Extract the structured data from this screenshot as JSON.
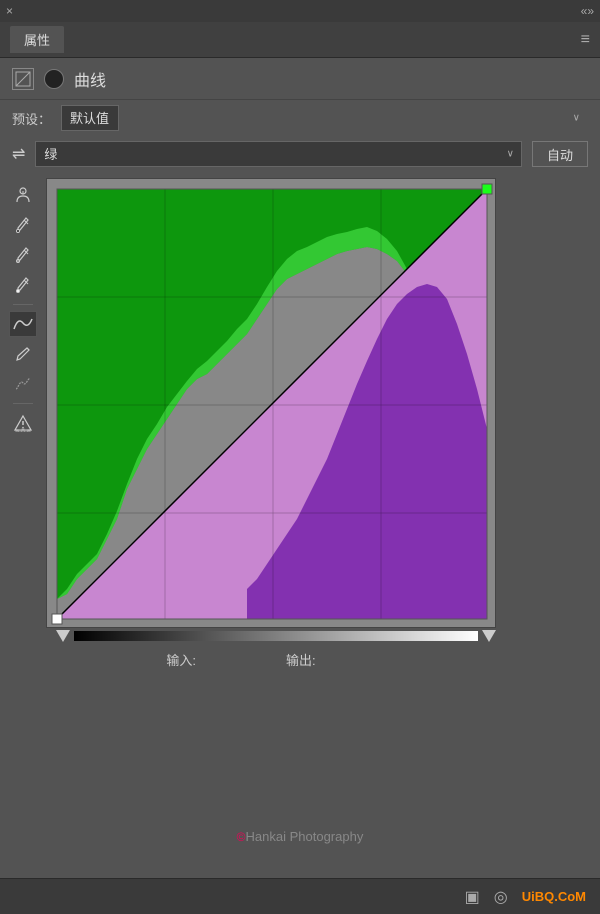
{
  "topbar": {
    "close_label": "×",
    "arrows_label": "«»"
  },
  "panel": {
    "tab_label": "属性",
    "menu_icon": "≡"
  },
  "curves": {
    "title": "曲线",
    "preset_label": "预设：",
    "preset_value": "默认值",
    "channel_value": "绿",
    "auto_label": "自动"
  },
  "tools": [
    {
      "name": "finger-tool",
      "icon": "⊕",
      "active": false
    },
    {
      "name": "eyedropper-black",
      "icon": "✒",
      "active": false
    },
    {
      "name": "eyedropper-gray",
      "icon": "✒",
      "active": false
    },
    {
      "name": "eyedropper-white",
      "icon": "✒",
      "active": false
    },
    {
      "name": "curve-tool",
      "icon": "∿",
      "active": true
    },
    {
      "name": "pencil-tool",
      "icon": "✏",
      "active": false
    },
    {
      "name": "smooth-tool",
      "icon": "∫",
      "active": false
    },
    {
      "name": "warning-tool",
      "icon": "⚠",
      "active": false
    }
  ],
  "io": {
    "input_label": "输入:",
    "output_label": "输出:",
    "input_value": "",
    "output_value": ""
  },
  "watermark": {
    "copyright": "©",
    "text": "Hankai Photography"
  },
  "bottom": {
    "icon1": "▣",
    "icon2": "◎",
    "logo": "UiBQ.CoM"
  },
  "colors": {
    "green_histogram": "#00aa00",
    "green_histogram_light": "#44cc44",
    "purple_area": "#9b5fc0",
    "purple_light": "#cc88cc",
    "bg": "#535353",
    "chart_bg": "#888888"
  }
}
